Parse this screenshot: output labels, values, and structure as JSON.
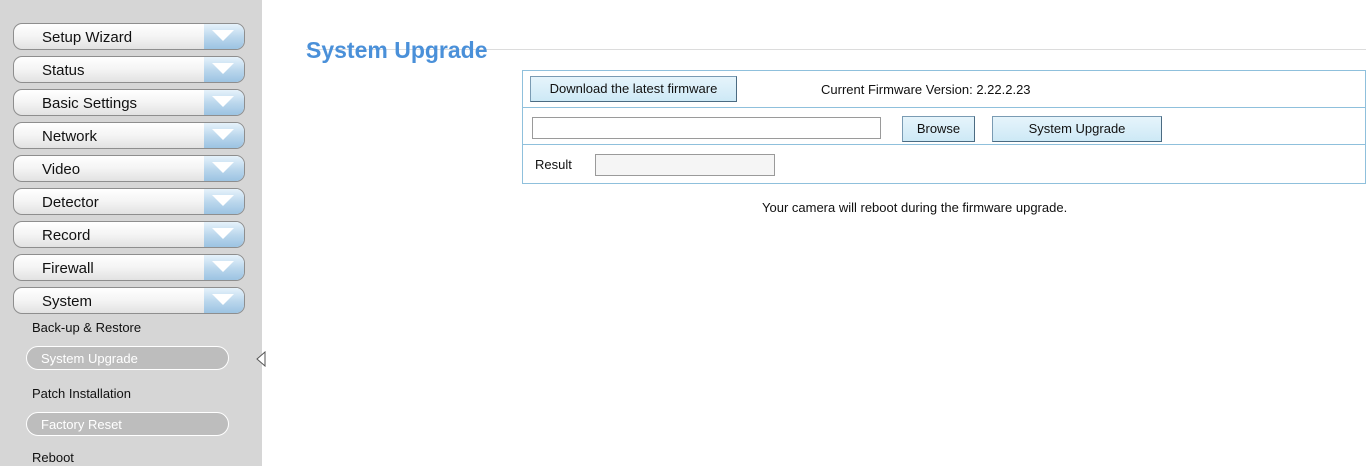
{
  "sidebar": {
    "menu": [
      {
        "label": "Setup Wizard"
      },
      {
        "label": "Status"
      },
      {
        "label": "Basic Settings"
      },
      {
        "label": "Network"
      },
      {
        "label": "Video"
      },
      {
        "label": "Detector"
      },
      {
        "label": "Record"
      },
      {
        "label": "Firewall"
      },
      {
        "label": "System"
      }
    ],
    "submenu": [
      {
        "label": "Back-up & Restore"
      },
      {
        "label": "System Upgrade",
        "selected": true
      },
      {
        "label": "Patch Installation"
      },
      {
        "label": "Factory Reset"
      },
      {
        "label": "Reboot"
      }
    ]
  },
  "main": {
    "title": "System Upgrade",
    "download_button": "Download the latest firmware",
    "firmware_version_text": "Current Firmware Version: 2.22.2.23",
    "file_path_value": "",
    "browse_button": "Browse",
    "upgrade_button": "System Upgrade",
    "result_label": "Result",
    "result_value": "",
    "note": "Your camera will reboot during the firmware upgrade."
  },
  "colors": {
    "title": "#4a90d9",
    "sidebar_bg": "#d6d6d6",
    "panel_border": "#8fc0dc",
    "button_bg": "#cde9f6"
  }
}
